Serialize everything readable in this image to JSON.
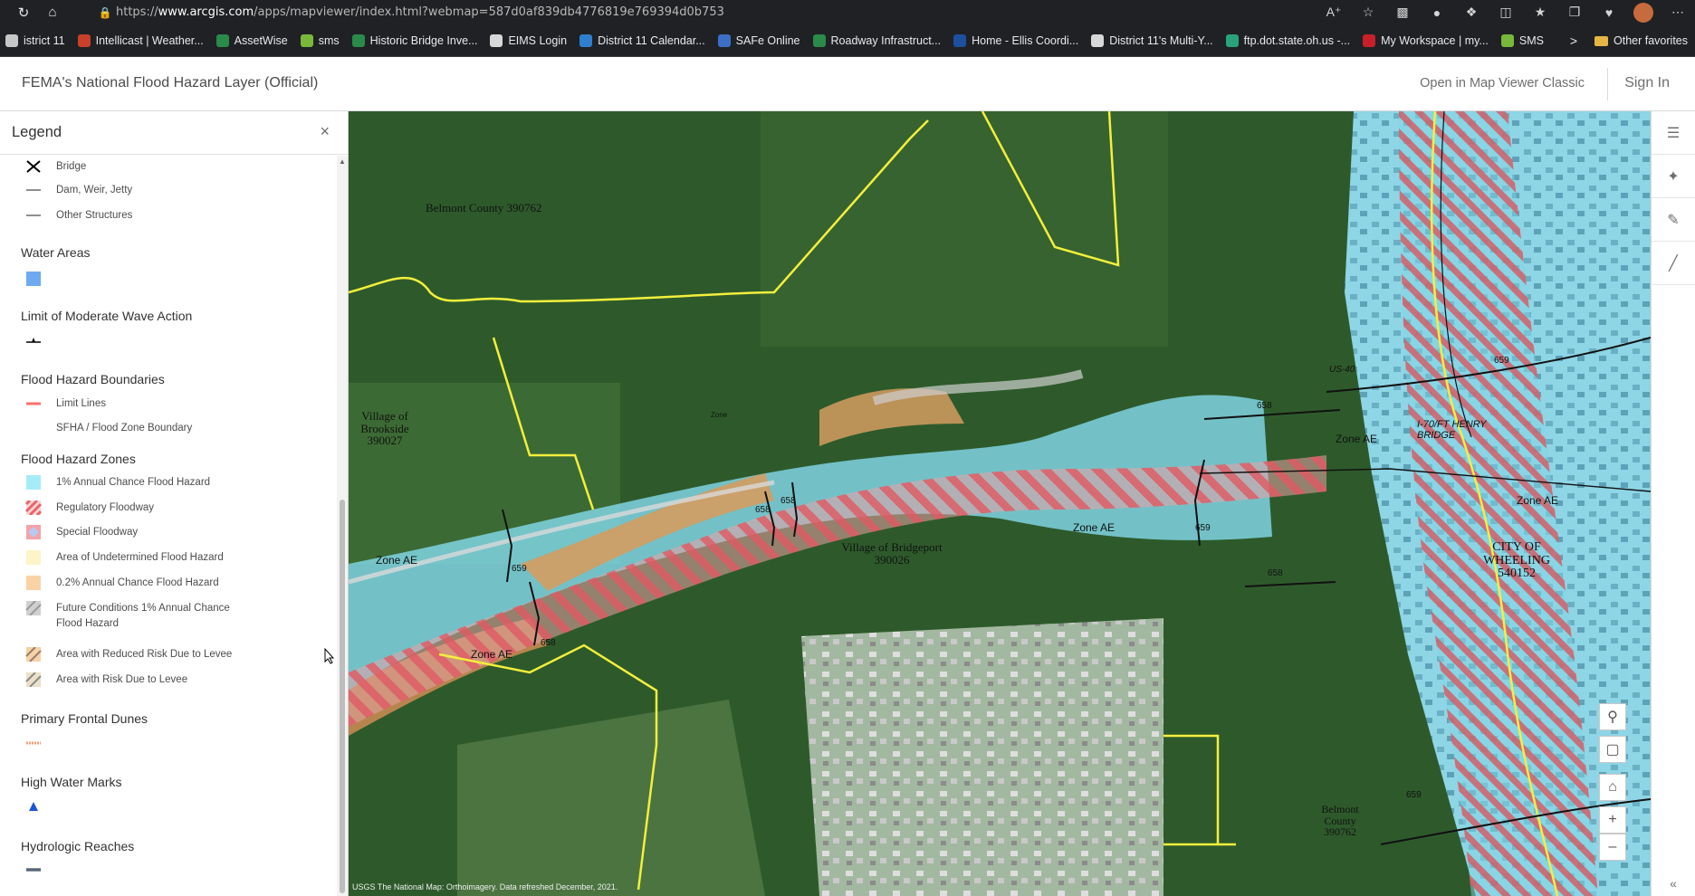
{
  "browser": {
    "url_prefix": "https://",
    "url_host": "www.arcgis.com",
    "url_rest": "/apps/mapviewer/index.html?webmap=587d0af839db4776819e769394d0b753"
  },
  "favorites": [
    {
      "label": "istrict 11",
      "color": "#c7c7c7"
    },
    {
      "label": "Intellicast | Weather...",
      "color": "#c8402a"
    },
    {
      "label": "AssetWise",
      "color": "#2a8a4a"
    },
    {
      "label": "sms",
      "color": "#79b83a"
    },
    {
      "label": "Historic Bridge Inve...",
      "color": "#2a8a4a"
    },
    {
      "label": "EIMS Login",
      "color": "#d8d8d8"
    },
    {
      "label": "District 11 Calendar...",
      "color": "#2f7fd1"
    },
    {
      "label": "SAFe Online",
      "color": "#3c6ec5"
    },
    {
      "label": "Roadway Infrastruct...",
      "color": "#2a8a4a"
    },
    {
      "label": "Home - Ellis Coordi...",
      "color": "#1e4f9e"
    },
    {
      "label": "District 11's Multi-Y...",
      "color": "#d8d8d8"
    },
    {
      "label": "ftp.dot.state.oh.us -...",
      "color": "#2aa37a"
    },
    {
      "label": "My Workspace | my...",
      "color": "#c8202a"
    },
    {
      "label": "SMS",
      "color": "#79b83a"
    }
  ],
  "favorites_more": ">",
  "favorites_other": "Other favorites",
  "header": {
    "title": "FEMA's National Flood Hazard Layer (Official)",
    "open_classic": "Open in Map Viewer Classic",
    "sign_in": "Sign In"
  },
  "legend": {
    "title": "Legend",
    "close": "×",
    "items_top": [
      {
        "label": "Bridge"
      },
      {
        "label": "Dam, Weir, Jetty"
      },
      {
        "label": "Other Structures"
      }
    ],
    "sections": {
      "water_areas": "Water Areas",
      "wave_action": "Limit of Moderate Wave Action",
      "boundaries": "Flood Hazard Boundaries",
      "zones": "Flood Hazard Zones",
      "dunes": "Primary Frontal Dunes",
      "hwm": "High Water Marks",
      "reaches": "Hydrologic Reaches"
    },
    "boundary_items": [
      {
        "label": "Limit Lines"
      },
      {
        "label": "SFHA / Flood Zone Boundary"
      }
    ],
    "zone_items": [
      {
        "label": "1% Annual Chance Flood Hazard",
        "color": "#a6ecf7"
      },
      {
        "label": "Regulatory Floodway",
        "color": "#f7a7a7"
      },
      {
        "label": "Special Floodway",
        "color": "#f7a7a7"
      },
      {
        "label": "Area of Undetermined Flood Hazard",
        "color": "#fdf4c8"
      },
      {
        "label": "0.2% Annual Chance Flood Hazard",
        "color": "#f9d3a6"
      },
      {
        "label": "Future Conditions 1% Annual Chance Flood Hazard",
        "color": "#c8c8c8"
      },
      {
        "label": "Area with Reduced Risk Due to Levee",
        "color": "#f6d2a8"
      },
      {
        "label": "Area with Risk Due to Levee",
        "color": "#d8d8c8"
      }
    ]
  },
  "map": {
    "labels": {
      "belmont_top": "Belmont County 390762",
      "brookside": "Village of Brookside 390027",
      "bridgeport": "Village of Bridgeport 390026",
      "wheeling": "CITY OF WHEELING 540152",
      "belmont_bottom": "Belmont County 390762",
      "bridge": "I-70/FT HENRY BRIDGE",
      "us40": "US-40"
    },
    "zone_labels": [
      "Zone AE",
      "Zone AE",
      "Zone AE",
      "Zone AE",
      "Zone AE"
    ],
    "small_zone": "Zone",
    "bfe": [
      "659",
      "658",
      "658",
      "658",
      "658",
      "659",
      "659",
      "659",
      "658"
    ],
    "attribution": "USGS The National Map: Orthoimagery. Data refreshed December, 2021."
  },
  "colors": {
    "flood": "#3fc6e0",
    "floodway": "#e8646a",
    "shaded": "#e8b07a",
    "boundary": "#f3ef3c",
    "forest": "#2f5a2c"
  }
}
